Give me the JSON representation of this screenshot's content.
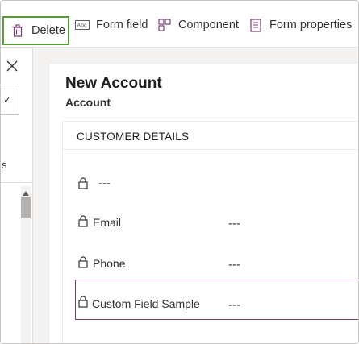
{
  "toolbar": {
    "delete_label": "Delete",
    "form_field_label": "Form field",
    "component_label": "Component",
    "form_properties_label": "Form properties",
    "highlight_color": "#5a9a3a"
  },
  "left_panel": {
    "fragment_text": "s",
    "check_symbol": "✓"
  },
  "form": {
    "title": "New Account",
    "entity": "Account",
    "section": {
      "title": "CUSTOMER DETAILS",
      "fields": [
        {
          "label": "",
          "value": "---"
        },
        {
          "label": "Email",
          "value": "---"
        },
        {
          "label": "Phone",
          "value": "---"
        },
        {
          "label": "Custom Field Sample",
          "value": "---"
        }
      ]
    },
    "selected_border_color": "#7a3d7a"
  }
}
